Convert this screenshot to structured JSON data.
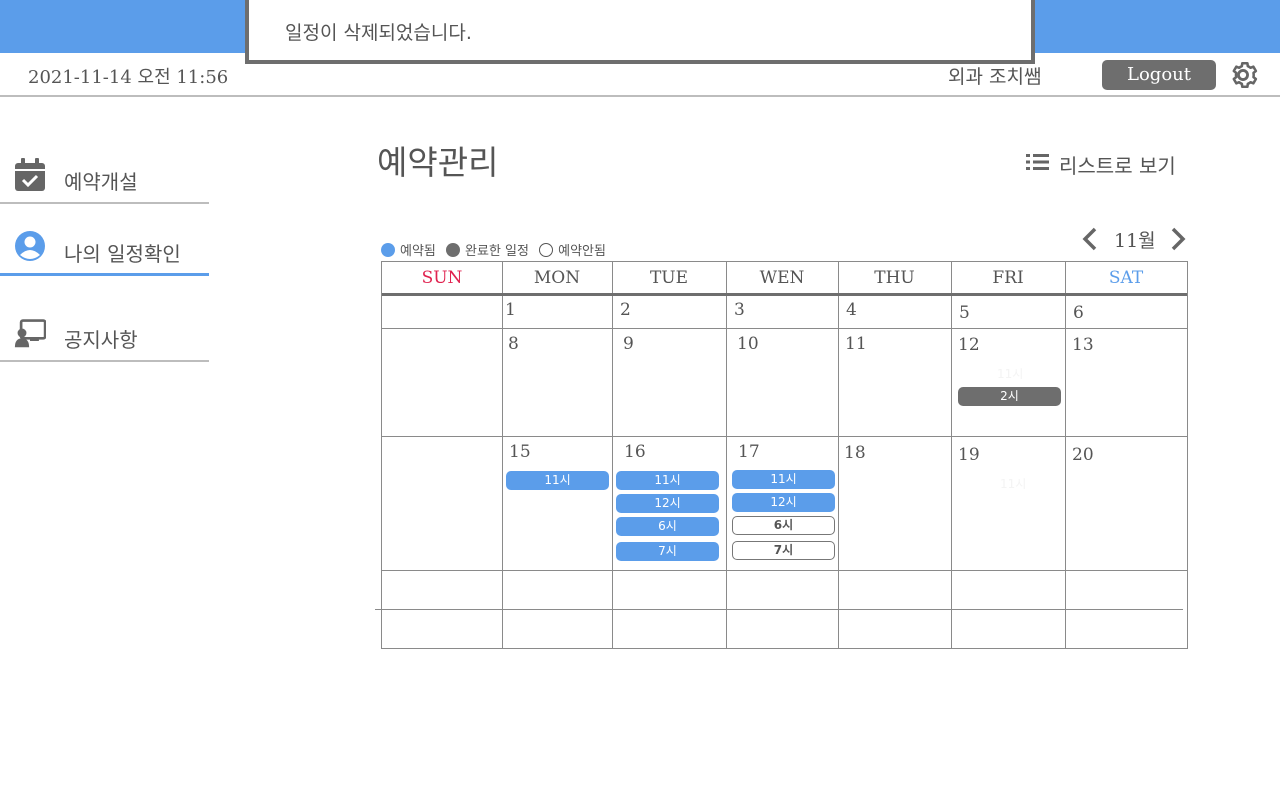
{
  "toast": {
    "message": "일정이 삭제되었습니다."
  },
  "header": {
    "datetime": "2021-11-14 오전 11:56",
    "user": "외과 조치쌤",
    "logout_label": "Logout",
    "settings_icon": "gear-icon"
  },
  "sidebar": {
    "items": [
      {
        "label": "예약개설",
        "icon": "calendar-check-icon",
        "active": false
      },
      {
        "label": "나의 일정확인",
        "icon": "user-circle-icon",
        "active": true
      },
      {
        "label": "공지사항",
        "icon": "presentation-icon",
        "active": false
      }
    ]
  },
  "main": {
    "title": "예약관리",
    "list_view_label": "리스트로 보기"
  },
  "legend": {
    "booked": "예약됨",
    "completed": "완료한 일정",
    "open": "예약안됨"
  },
  "calendar": {
    "month_label": "11월",
    "days_of_week": [
      "SUN",
      "MON",
      "TUE",
      "WEN",
      "THU",
      "FRI",
      "SAT"
    ],
    "weeks": [
      [
        "",
        "1",
        "2",
        "3",
        "4",
        "5",
        "6"
      ],
      [
        "",
        "8",
        "9",
        "10",
        "11",
        "12",
        "13"
      ],
      [
        "",
        "15",
        "16",
        "17",
        "18",
        "19",
        "20"
      ],
      [
        "",
        "",
        "",
        "",
        "",
        "",
        ""
      ],
      [
        "",
        "",
        "",
        "",
        "",
        "",
        ""
      ]
    ],
    "events": {
      "fri12": {
        "faint": "11시",
        "e1": "2시"
      },
      "mon15": {
        "e1": "11시"
      },
      "tue16": {
        "e1": "11시",
        "e2": "12시",
        "e3": "6시",
        "e4": "7시"
      },
      "wed17": {
        "e1": "11시",
        "e2": "12시",
        "e3": "6시",
        "e4": "7시"
      },
      "fri19": {
        "faint": "11시"
      }
    }
  },
  "colors": {
    "accent": "#5b9dea",
    "completed": "#6e6e6e",
    "sunday": "#e0224f",
    "saturday": "#5b9dea"
  }
}
